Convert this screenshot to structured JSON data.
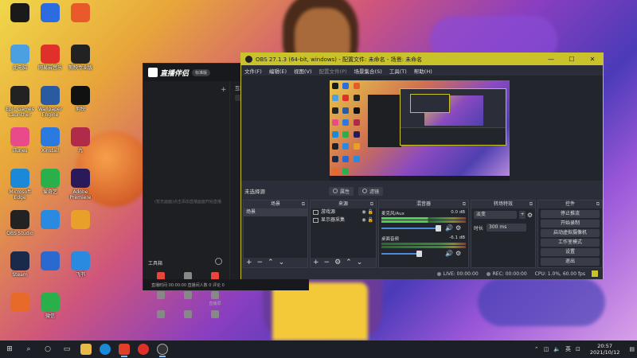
{
  "desktop": {
    "icons": [
      {
        "label": "",
        "color": "#1a1a1a"
      },
      {
        "label": "",
        "color": "#2d6be0"
      },
      {
        "label": "",
        "color": "#e85a2a"
      },
      {
        "label": "此电脑",
        "color": "#4aa0e0"
      },
      {
        "label": "网易云音乐",
        "color": "#e0302a"
      },
      {
        "label": "剪映专业版",
        "color": "#222"
      },
      {
        "label": "Epic Games Launcher",
        "color": "#222"
      },
      {
        "label": "Wallpaper Engine",
        "color": "#2a5aa0"
      },
      {
        "label": "剪映",
        "color": "#111"
      },
      {
        "label": "iTunes",
        "color": "#e84a8a"
      },
      {
        "label": "Xinstall",
        "color": "#2a7ae0"
      },
      {
        "label": "九",
        "color": "#b02a4a"
      },
      {
        "label": "Microsoft Edge",
        "color": "#1a8ad8"
      },
      {
        "label": "爱奇艺",
        "color": "#2ab04a"
      },
      {
        "label": "Adobe Premiere",
        "color": "#2a1a5a"
      },
      {
        "label": "OBS Studio",
        "color": "#222"
      },
      {
        "label": "",
        "color": "#2a8ae0"
      },
      {
        "label": "",
        "color": "#e8a02a"
      },
      {
        "label": "Steam",
        "color": "#1a2a4a"
      },
      {
        "label": "",
        "color": "#2a6ad0"
      },
      {
        "label": "飞书",
        "color": "#2a8ae0"
      },
      {
        "label": "",
        "color": "#e86a2a"
      },
      {
        "label": "微信",
        "color": "#2ab04a"
      }
    ]
  },
  "zhibo": {
    "app_name": "直播伴侣",
    "badge": "标准版",
    "empty_hint": "(暂无画面)点击添加直播画面开始直播",
    "tools_title": "工具箱",
    "tools": [
      {
        "label": "添加素材",
        "red": true
      },
      {
        "label": "观看助手",
        "red": false
      },
      {
        "label": "主播任务",
        "red": true
      },
      {
        "label": "",
        "red": false
      },
      {
        "label": "",
        "red": false
      },
      {
        "label": "直播屏",
        "red": false
      },
      {
        "label": "",
        "red": false
      },
      {
        "label": "",
        "red": false
      },
      {
        "label": "",
        "red": false
      }
    ],
    "right_head": "互动",
    "status_text": "直播时间 00:00:00 直播间人数 0 评论 0"
  },
  "obs": {
    "title": "OBS 27.1.3 (64-bit, windows) - 配置文件: 未命名 - 场景: 未命名",
    "menu": [
      "文件(F)",
      "编辑(E)",
      "视图(V)",
      "配置文件(P)",
      "场景集合(S)",
      "工具(T)",
      "帮助(H)"
    ],
    "current_scene_label": "未选择源",
    "props_btn": "属性",
    "filters_btn": "滤镜",
    "scenes_header": "场景",
    "scenes": [
      "场景"
    ],
    "sources_header": "来源",
    "sources": [
      "游戏源",
      "显示器采集"
    ],
    "mixer_header": "混音器",
    "mixer": [
      {
        "name": "麦克风/Aux",
        "db": "0.0 dB",
        "active": true
      },
      {
        "name": "桌面音频",
        "db": "-6.1 dB",
        "active": false
      }
    ],
    "transitions_header": "转场特效",
    "transition_type": "淡变",
    "duration_label": "时长",
    "duration_value": "300 ms",
    "controls_header": "控件",
    "controls": [
      "停止推流",
      "开始录制",
      "启动虚拟摄像机",
      "工作室模式",
      "设置",
      "退出"
    ],
    "status": {
      "live": "LIVE: 00:00:00",
      "rec": "REC: 00:00:00",
      "cpu": "CPU: 1.0%, 60.00 fps"
    }
  },
  "taskbar": {
    "apps": [
      "start",
      "search",
      "task-view",
      "explorer",
      "edge",
      "douyin-zhibo",
      "netease",
      "obs"
    ],
    "tray": {
      "lang": "英",
      "time": "20:57",
      "date": "2021/10/12"
    }
  }
}
